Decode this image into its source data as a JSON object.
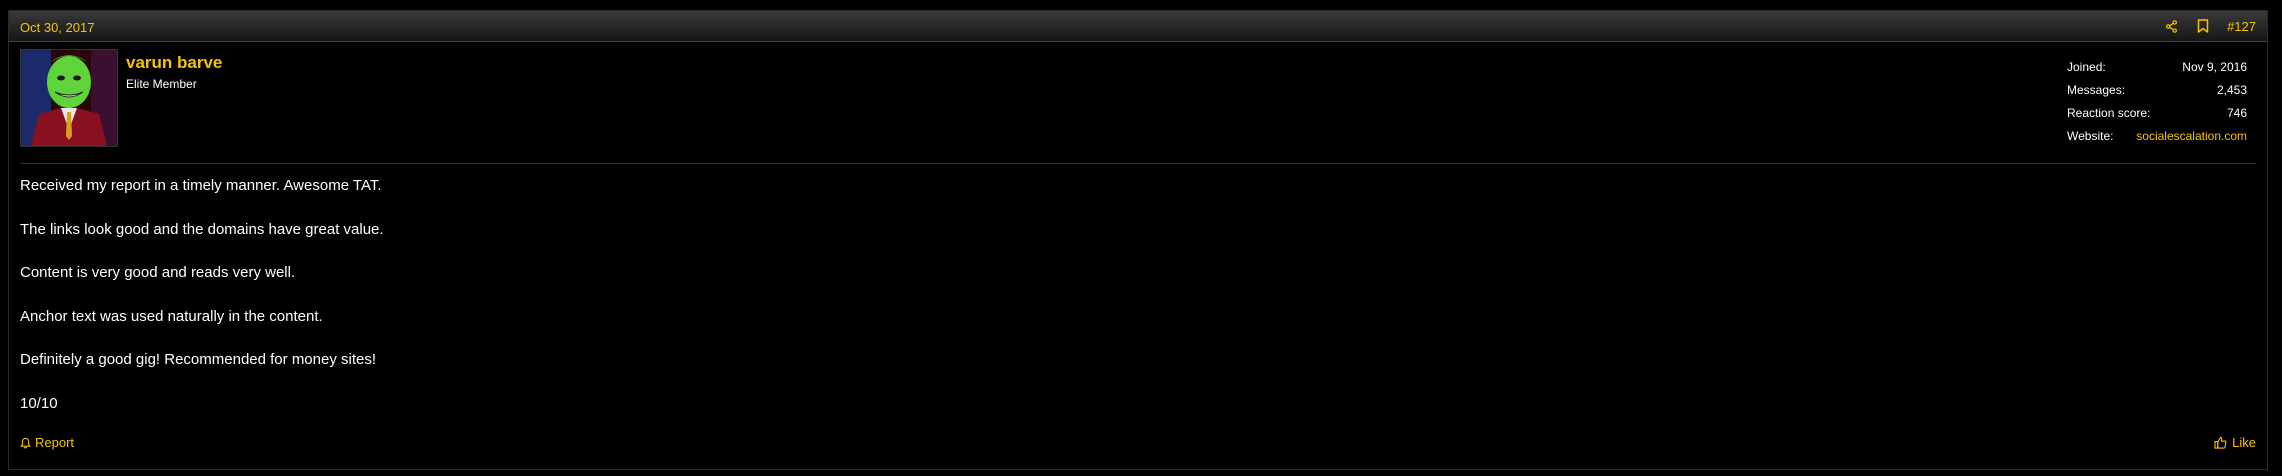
{
  "post": {
    "date": "Oct 30, 2017",
    "number": "#127",
    "actions": {
      "share_icon": "share-icon",
      "bookmark_icon": "bookmark-icon"
    }
  },
  "user": {
    "name": "varun barve",
    "title": "Elite Member",
    "avatar_alt": "avatar"
  },
  "stats": [
    {
      "label": "Joined:",
      "value": "Nov 9, 2016"
    },
    {
      "label": "Messages:",
      "value": "2,453"
    },
    {
      "label": "Reaction score:",
      "value": "746"
    },
    {
      "label": "Website:",
      "value": "socialescalation.com"
    }
  ],
  "body_lines": [
    "Received my report in a timely manner. Awesome TAT.",
    "The links look good and the domains have great value.",
    "Content is very good and reads very well.",
    "Anchor text was used naturally in the content.",
    "Definitely a good gig! Recommended for money sites!",
    "10/10"
  ],
  "footer": {
    "report_label": "Report",
    "like_label": "Like"
  },
  "colors": {
    "accent": "#f5c400",
    "background": "#000000",
    "text": "#ffffff"
  }
}
